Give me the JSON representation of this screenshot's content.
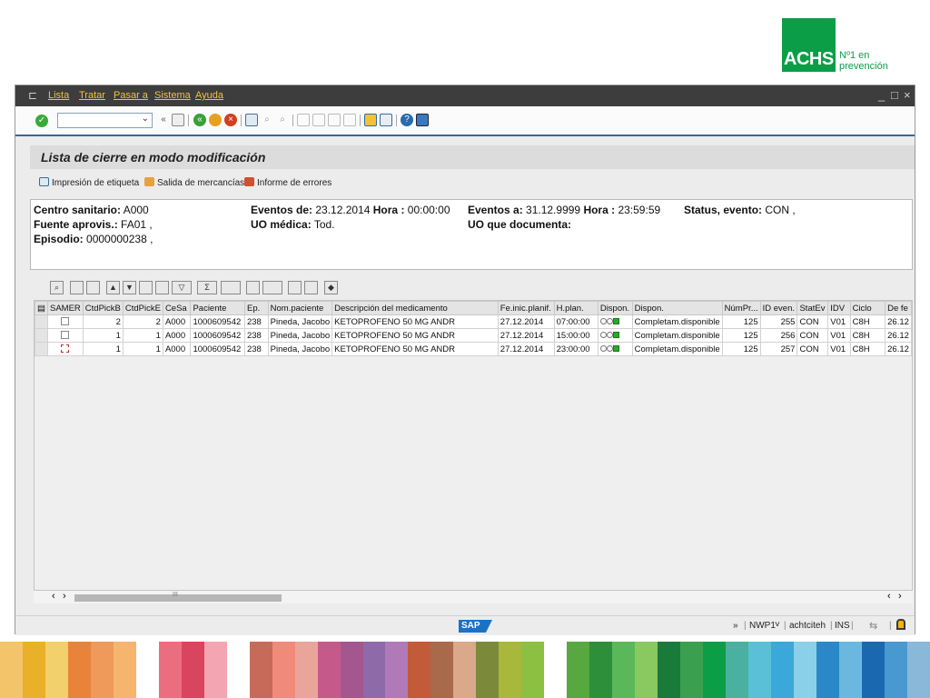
{
  "logo": {
    "brand": "ACHS",
    "tagline_1": "Nº1 en",
    "tagline_2": "prevención",
    "color": "#0b9e47"
  },
  "menubar": {
    "items": [
      "Lista",
      "Tratar",
      "Pasar a",
      "Sistema",
      "Ayuda"
    ],
    "win_controls": [
      "_",
      "□",
      "×"
    ]
  },
  "toolbar": {
    "command_field_value": "",
    "back_label": "«"
  },
  "title": "Lista de cierre en modo modificación",
  "app_buttons": [
    "Impresión de etiqueta",
    "Salida de mercancías",
    "Informe de errores"
  ],
  "header": {
    "centro_label": "Centro sanitario:",
    "centro_value": "A000",
    "fuente_label": "Fuente aprovis.:",
    "fuente_value": "FA01 ,",
    "episodio_label": "Episodio:",
    "episodio_value": "0000000238 ,",
    "eventos_de_label": "Eventos de:",
    "eventos_de_value": "23.12.2014",
    "hora1_label": "Hora :",
    "hora1_value": "00:00:00",
    "uo_medica_label": "UO médica:",
    "uo_medica_value": "Tod.",
    "eventos_a_label": "Eventos a:",
    "eventos_a_value": "31.12.9999",
    "hora2_label": "Hora :",
    "hora2_value": "23:59:59",
    "uo_doc_label": "UO que documenta:",
    "status_label": "Status, evento:",
    "status_value": "CON ,"
  },
  "grid": {
    "columns": [
      "SAMER",
      "CtdPickB",
      "CtdPickE",
      "CeSa",
      "Paciente",
      "Ep.",
      "Nom.paciente",
      "Descripción del medicamento",
      "Fe.inic.planif.",
      "H.plan.",
      "Dispon.",
      "Dispon.",
      "NúmPr...",
      "ID even.",
      "StatEv",
      "IDV",
      "Ciclo",
      "De fe"
    ],
    "rows": [
      {
        "ctdpickb": "2",
        "ctdpicke": "2",
        "cesa": "A000",
        "paciente": "1000609542",
        "ep": "238",
        "nom": "Pineda, Jacobo",
        "desc": "KETOPROFENO 50 MG ANDR",
        "fecha": "27.12.2014",
        "hplan": "07:00:00",
        "dispon_text": "Completam.disponible",
        "numpr": "125",
        "id_even": "255",
        "statev": "CON",
        "idv": "V01",
        "ciclo": "C8H",
        "defe": "26.12"
      },
      {
        "ctdpickb": "1",
        "ctdpicke": "1",
        "cesa": "A000",
        "paciente": "1000609542",
        "ep": "238",
        "nom": "Pineda, Jacobo",
        "desc": "KETOPROFENO 50 MG ANDR",
        "fecha": "27.12.2014",
        "hplan": "15:00:00",
        "dispon_text": "Completam.disponible",
        "numpr": "125",
        "id_even": "256",
        "statev": "CON",
        "idv": "V01",
        "ciclo": "C8H",
        "defe": "26.12"
      },
      {
        "ctdpickb": "1",
        "ctdpicke": "1",
        "cesa": "A000",
        "paciente": "1000609542",
        "ep": "238",
        "nom": "Pineda, Jacobo",
        "desc": "KETOPROFENO 50 MG ANDR",
        "fecha": "27.12.2014",
        "hplan": "23:00:00",
        "dispon_text": "Completam.disponible",
        "numpr": "125",
        "id_even": "257",
        "statev": "CON",
        "idv": "V01",
        "ciclo": "C8H",
        "defe": "26.12"
      }
    ]
  },
  "scroll": {
    "left": "‹",
    "right": "›",
    "thumb_mark": "III"
  },
  "statusbar": {
    "expand": "»",
    "system": "NWP1",
    "dropdown": "˅",
    "user": "achtciteh",
    "mode": "INS",
    "sap": "SAP"
  },
  "stripe_colors": [
    "#f4c46a",
    "#e9b02a",
    "#f2d06c",
    "#e8843a",
    "#ef9a5a",
    "#f6b56e",
    "#ffffff",
    "#eb6e7e",
    "#d9455f",
    "#f3a6b2",
    "#ffffff",
    "#c86a5a",
    "#f08a7a",
    "#e9a59a",
    "#c55a8a",
    "#a4578f",
    "#8f6aa8",
    "#b07ab8",
    "#c35a3a",
    "#a86a4a",
    "#d9a98a",
    "#7a8a3a",
    "#a8b83a",
    "#8cc040",
    "#ffffff",
    "#58a840",
    "#2e8f3a",
    "#5ab85a",
    "#8ac860",
    "#1a7a3a",
    "#3aa050",
    "#0b9e47",
    "#4ab0a0",
    "#5ac0d8",
    "#3aa8d8",
    "#8ad0e8",
    "#2a88c8",
    "#6ab8e0",
    "#1a68b0",
    "#4a98d0",
    "#8ab8d8"
  ]
}
